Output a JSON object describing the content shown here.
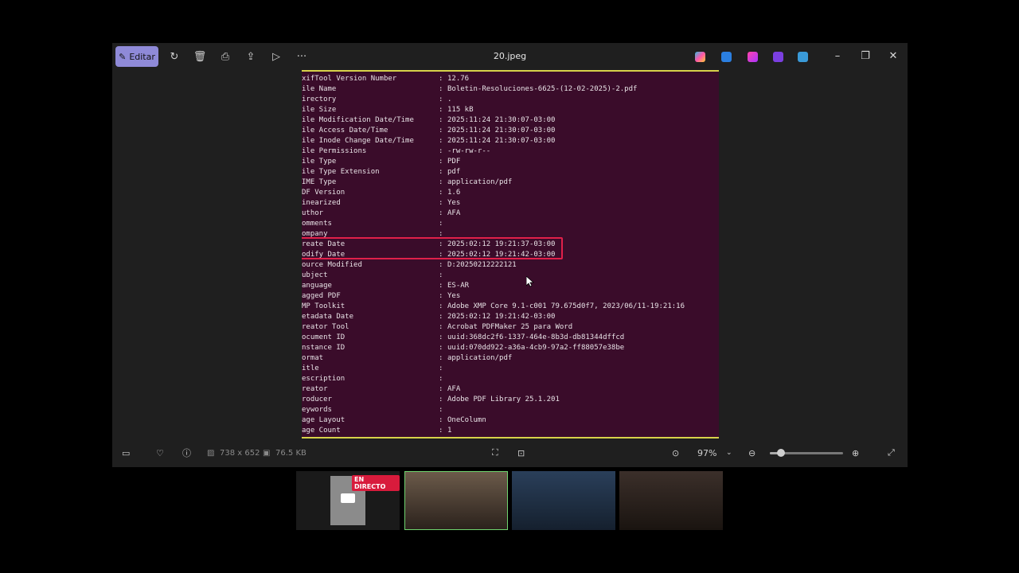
{
  "toolbar": {
    "edit_label": "Editar",
    "file_title": "20.jpeg"
  },
  "terminal_rows": [
    {
      "key": "xifTool Version Number",
      "value": "12.76"
    },
    {
      "key": "ile Name",
      "value": "Boletin-Resoluciones-6625-(12-02-2025)-2.pdf"
    },
    {
      "key": "irectory",
      "value": "."
    },
    {
      "key": "ile Size",
      "value": "115 kB"
    },
    {
      "key": "ile Modification Date/Time",
      "value": "2025:11:24 21:30:07-03:00"
    },
    {
      "key": "ile Access Date/Time",
      "value": "2025:11:24 21:30:07-03:00"
    },
    {
      "key": "ile Inode Change Date/Time",
      "value": "2025:11:24 21:30:07-03:00"
    },
    {
      "key": "ile Permissions",
      "value": "-rw-rw-r--"
    },
    {
      "key": "ile Type",
      "value": "PDF"
    },
    {
      "key": "ile Type Extension",
      "value": "pdf"
    },
    {
      "key": "IME Type",
      "value": "application/pdf"
    },
    {
      "key": "DF Version",
      "value": "1.6"
    },
    {
      "key": "inearized",
      "value": "Yes"
    },
    {
      "key": "uthor",
      "value": "AFA"
    },
    {
      "key": "omments",
      "value": ""
    },
    {
      "key": "ompany",
      "value": ""
    },
    {
      "key": "reate Date",
      "value": "2025:02:12 19:21:37-03:00"
    },
    {
      "key": "odify Date",
      "value": "2025:02:12 19:21:42-03:00"
    },
    {
      "key": "ource Modified",
      "value": "D:20250212222121"
    },
    {
      "key": "ubject",
      "value": ""
    },
    {
      "key": "anguage",
      "value": "ES-AR"
    },
    {
      "key": "agged PDF",
      "value": "Yes"
    },
    {
      "key": "MP Toolkit",
      "value": "Adobe XMP Core 9.1-c001 79.675d0f7, 2023/06/11-19:21:16"
    },
    {
      "key": "etadata Date",
      "value": "2025:02:12 19:21:42-03:00"
    },
    {
      "key": "reator Tool",
      "value": "Acrobat PDFMaker 25 para Word"
    },
    {
      "key": "ocument ID",
      "value": "uuid:368dc2f6-1337-464e-8b3d-db81344dffcd"
    },
    {
      "key": "nstance ID",
      "value": "uuid:070dd922-a36a-4cb9-97a2-ff88057e38be"
    },
    {
      "key": "ormat",
      "value": "application/pdf"
    },
    {
      "key": "itle",
      "value": ""
    },
    {
      "key": "escription",
      "value": ""
    },
    {
      "key": "reator",
      "value": "AFA"
    },
    {
      "key": "roducer",
      "value": "Adobe PDF Library 25.1.201"
    },
    {
      "key": "eywords",
      "value": ""
    },
    {
      "key": "age Layout",
      "value": "OneColumn"
    },
    {
      "key": "age Count",
      "value": "1"
    }
  ],
  "status": {
    "dimensions": "738 x 652",
    "file_size": "76.5 KB",
    "zoom": "97%",
    "zoom_fraction": 0.15
  },
  "live_badge": "EN DIRECTO",
  "colors": {
    "terminal_bg": "#3a0c2a",
    "highlight": "#e0204a",
    "edit_accent": "#8f8ad8"
  }
}
